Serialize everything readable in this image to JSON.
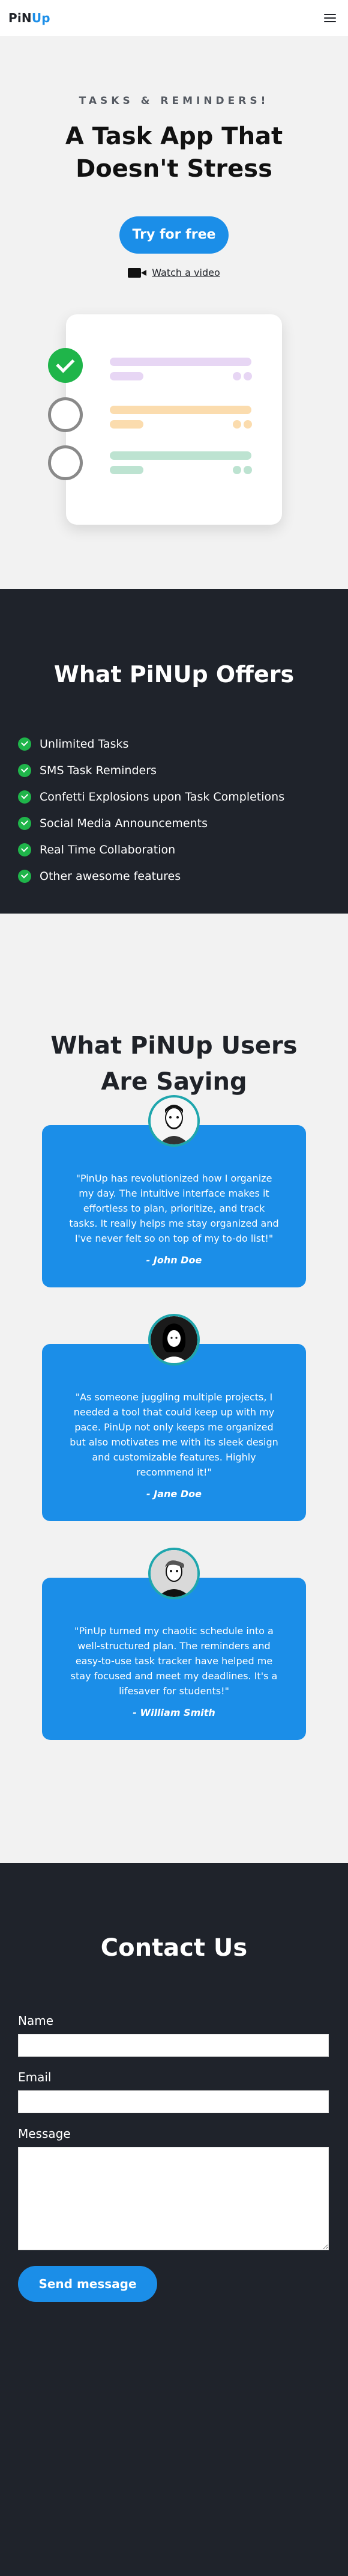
{
  "nav": {
    "brand_pin": "PiN",
    "brand_up": "Up",
    "menu_icon": "hamburger-icon"
  },
  "hero": {
    "eyebrow": "TASKS & REMINDERS!",
    "title": "A Task App That Doesn't Stress",
    "cta_label": "Try for free",
    "video_icon": "video-camera-icon",
    "video_link": "Watch a video"
  },
  "offers": {
    "title": "What PiNUp Offers",
    "items": [
      "Unlimited Tasks",
      "SMS Task Reminders",
      "Confetti Explosions upon Task Completions",
      "Social Media Announcements",
      "Real Time Collaboration",
      "Other awesome features"
    ]
  },
  "testimonials": {
    "title": "What PiNUp Users Are Saying",
    "items": [
      {
        "quote": "\"PinUp has revolutionized how I organize my day. The intuitive interface makes it effortless to plan, prioritize, and track tasks. It really helps me stay organized and I've never felt so on top of my to-do list!\"",
        "author": "- John Doe"
      },
      {
        "quote": "\"As someone juggling multiple projects, I needed a tool that could keep up with my pace. PinUp not only keeps me organized but also motivates me with its sleek design and customizable features. Highly recommend it!\"",
        "author": "- Jane Doe"
      },
      {
        "quote": "\"PinUp turned my chaotic schedule into a well-structured plan. The reminders and easy-to-use task tracker have helped me stay focused and meet my deadlines. It's a lifesaver for students!\"",
        "author": "- William Smith"
      }
    ]
  },
  "contact": {
    "title": "Contact Us",
    "name_label": "Name",
    "email_label": "Email",
    "message_label": "Message",
    "send_label": "Send message"
  },
  "colors": {
    "accent": "#1b8ee8",
    "dark": "#1f232b",
    "light": "#f2f2f2",
    "success": "#1fb54a"
  }
}
